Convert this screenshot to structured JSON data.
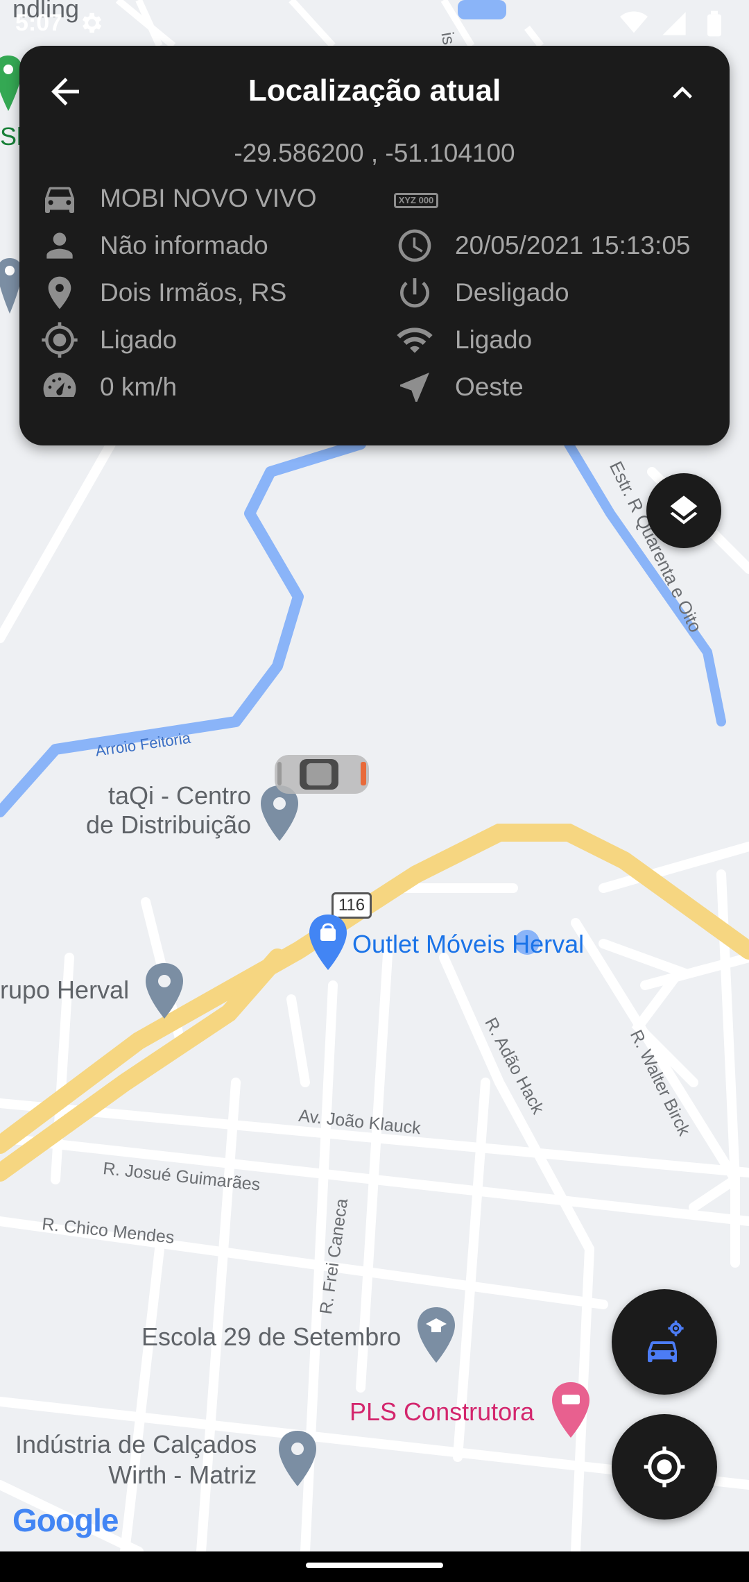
{
  "status_bar": {
    "time": "5:07"
  },
  "card": {
    "title": "Localização atual",
    "coordinates": "-29.586200 , -51.104100",
    "plate_badge": "XYZ 000",
    "left_items": [
      {
        "icon": "car-icon",
        "text": "MOBI NOVO VIVO"
      },
      {
        "icon": "person-icon",
        "text": "Não informado"
      },
      {
        "icon": "location-pin-icon",
        "text": "Dois Irmãos, RS"
      },
      {
        "icon": "gps-target-icon",
        "text": "Ligado"
      },
      {
        "icon": "speedometer-icon",
        "text": "0 km/h"
      }
    ],
    "right_items": [
      {
        "icon": "clock-icon",
        "text": "20/05/2021 15:13:05"
      },
      {
        "icon": "power-icon",
        "text": "Desligado"
      },
      {
        "icon": "wifi-icon",
        "text": "Ligado"
      },
      {
        "icon": "navigation-arrow-icon",
        "text": "Oeste"
      }
    ]
  },
  "map": {
    "places": {
      "taqi": [
        "taQi - Centro",
        "de Distribuição"
      ],
      "outlet": "Outlet Móveis Herval",
      "grupo": "rupo Herval",
      "escola": "Escola 29 de Setembro",
      "pls": "PLS Construtora",
      "industria": [
        "Indústria de Calçados",
        "Wirth - Matriz"
      ],
      "top_partial": "ndling",
      "left_partial": "Sk"
    },
    "streets": {
      "arroio": "Arroio Feitoria",
      "estr": "Estr. R Quarenta e Oito",
      "adao": "R. Adão Hack",
      "walter": "R. Walter Birck",
      "joao": "Av. João Klauck",
      "josue": "R. Josué Guimarães",
      "chico": "R. Chico Mendes",
      "frei": "R. Frei Caneca",
      "top_vertical": "is"
    },
    "highway_shield": "116",
    "google_logo": "Google"
  },
  "colors": {
    "card_bg": "#1b1b1b",
    "map_bg": "#eef0f3",
    "highway": "#f6d681",
    "water": "#8ab4f8",
    "accent_blue": "#4c7cf5"
  }
}
